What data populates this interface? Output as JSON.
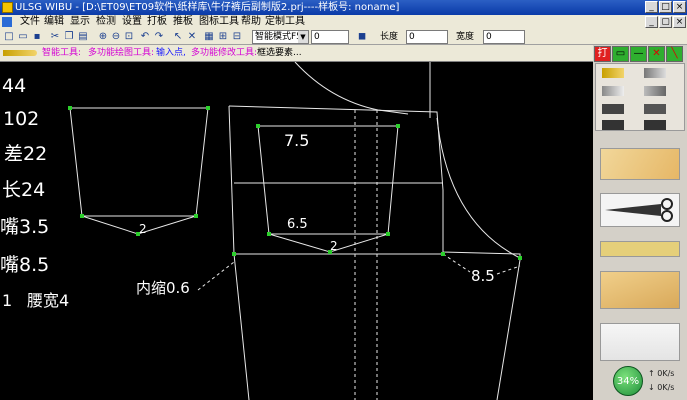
{
  "window": {
    "title": "ULSG WIBU - [D:\\ET09\\ET09软件\\纸样库\\牛仔裤后副制版2.prj----样板号: noname]",
    "controls": {
      "minimize": "_",
      "maximize": "□",
      "close": "×",
      "restore": "▢"
    }
  },
  "menu": {
    "items": [
      "文件",
      "编辑",
      "显示",
      "检测",
      "设置",
      "打板",
      "推板",
      "图标工具",
      "帮助",
      "定制工具"
    ]
  },
  "toolbar": {
    "mode_select": "智能模式F5",
    "mode_value": "0",
    "length_label": "长度",
    "length_value": "0",
    "width_label": "宽度",
    "width_value": "0"
  },
  "status": {
    "segments": [
      "智能工具:",
      "多功能绘图工具:",
      "输入点,",
      "多功能修改工具:",
      "框选要素..."
    ],
    "colors": [
      "#d400d4",
      "#d400d4",
      "#1a1aff",
      "#d400d4",
      "#000000"
    ]
  },
  "canvas": {
    "left_labels": [
      "44",
      "102",
      "差22",
      "长24",
      "嘴3.5",
      "嘴8.5",
      "腰宽4"
    ],
    "left_label_1_prefix": "1",
    "dim_labels": {
      "pocket1_bottom": "2",
      "yoke_top": "7.5",
      "yoke_mid": "6.5",
      "yoke_bottom": "2",
      "inner_shrink": "内缩0.6",
      "side_right": "8.5"
    }
  },
  "netinfo": {
    "speed_percent": "34%",
    "up": "0K/s",
    "down": "0K/s"
  }
}
